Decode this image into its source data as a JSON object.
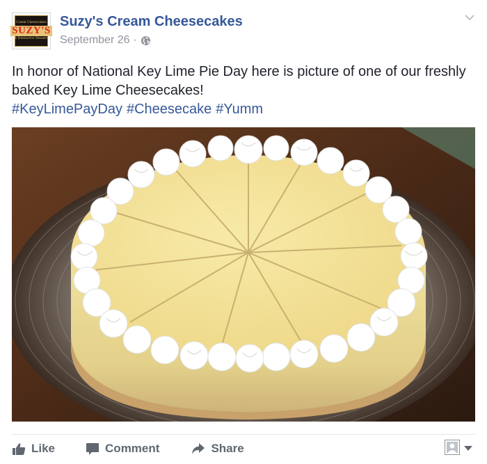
{
  "post": {
    "page_name": "Suzy's Cream Cheesecakes",
    "date": "September 26",
    "separator": "·",
    "privacy_icon": "globe-icon",
    "options_icon": "chevron-down-icon",
    "avatar": {
      "logo_top": "Cream Cheesecakes",
      "logo_main": "SUZY'S",
      "logo_bottom": "& Distinctive Desserts"
    },
    "message": "In honor of National Key Lime Pie Day here is picture of one of our freshly baked Key Lime Cheesecakes!",
    "hashtags": [
      "#KeyLimePayDay",
      "#Cheesecake",
      "#Yumm"
    ],
    "photo_subject": "key-lime-cheesecake-photo"
  },
  "actions": {
    "like_label": "Like",
    "comment_label": "Comment",
    "share_label": "Share",
    "like_icon": "thumbs-up-icon",
    "comment_icon": "speech-bubble-icon",
    "share_icon": "share-arrow-icon",
    "audience_icon": "page-avatar-icon",
    "audience_dropdown_icon": "caret-down-icon"
  },
  "colors": {
    "link_blue": "#365899",
    "meta_gray": "#90949c",
    "action_gray": "#606770",
    "text": "#1d2129"
  }
}
